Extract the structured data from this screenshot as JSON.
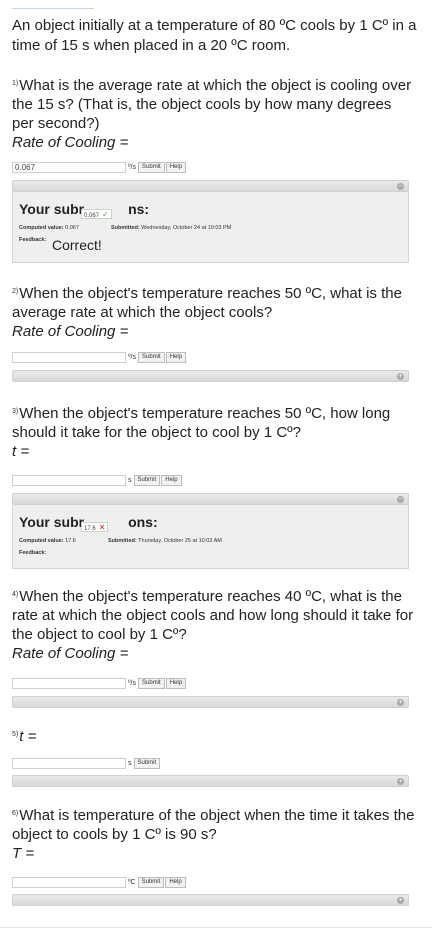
{
  "intro": "An object initially at a temperature of 80 ºC cools by 1 Cº in a time of 15 s when placed in a 20 ºC room.",
  "buttons": {
    "submit": "Submit",
    "help": "Help",
    "collapse": "−",
    "expand": "+"
  },
  "q1": {
    "num": "1)",
    "text": "What is the average rate at which the object is cooling over the 15 s? (That is, the object cools by how many degrees per second?)",
    "label": "Rate of Cooling =",
    "value": "0.067",
    "unit": "º/s",
    "submissions": {
      "title_start": "Your subr",
      "title_end": "ns:",
      "bubble_value": "0.067",
      "computed_label": "Computed value:",
      "computed_value": "0.067",
      "submitted_label": "Submitted:",
      "submitted_value": "Wednesday, October 24 at 10:03 PM",
      "feedback_label": "Feedback:",
      "feedback_value": "Correct!"
    }
  },
  "q2": {
    "num": "2)",
    "text": "When the object's temperature reaches 50 ºC, what is the average rate at which the object cools?",
    "label": "Rate of Cooling =",
    "value": "",
    "unit": "º/s"
  },
  "q3": {
    "num": "3)",
    "text": "When the object's temperature reaches 50 ºC, how long should it take for the object to cool by 1 Cº?",
    "label": "t =",
    "value": "",
    "unit": "s",
    "submissions": {
      "title_start": "Your subr",
      "title_end": "ons:",
      "bubble_value": "17.6",
      "computed_label": "Computed value:",
      "computed_value": "17.6",
      "submitted_label": "Submitted:",
      "submitted_value": "Thursday, October 25 at 10:03 AM",
      "feedback_label": "Feedback:"
    }
  },
  "q4": {
    "num": "4)",
    "text": "When the object's temperature reaches 40 ºC, what is the rate at which the object cools and how long should it take for the object to cool by 1 Cº?",
    "label": "Rate of Cooling =",
    "value": "",
    "unit": "º/s"
  },
  "q5": {
    "num": "5)",
    "label": "t =",
    "value": "",
    "unit": "s"
  },
  "q6": {
    "num": "6)",
    "text": "What is temperature of the object when the time it takes the object to cools by 1 Cº is 90 s?",
    "label": "T =",
    "value": "",
    "unit": "ºC"
  }
}
